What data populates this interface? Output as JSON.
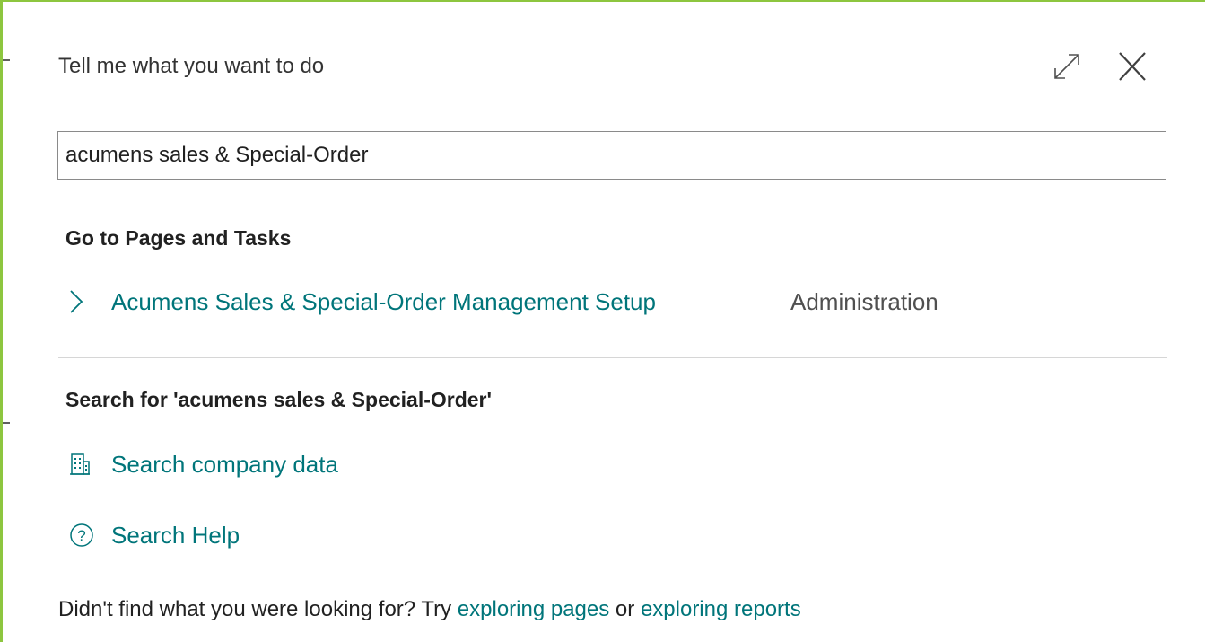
{
  "dialog": {
    "title": "Tell me what you want to do",
    "expand_icon": "expand-icon",
    "close_icon": "close-icon"
  },
  "search": {
    "value": "acumens sales & Special-Order",
    "placeholder": ""
  },
  "pages_section": {
    "heading": "Go to Pages and Tasks",
    "results": [
      {
        "icon": "chevron-right-icon",
        "label": "Acumens Sales & Special-Order Management Setup",
        "category": "Administration"
      }
    ]
  },
  "search_section": {
    "heading": "Search for 'acumens sales & Special-Order'",
    "items": [
      {
        "icon": "building-icon",
        "label": "Search company data"
      },
      {
        "icon": "help-circle-icon",
        "label": "Search Help"
      }
    ]
  },
  "footer": {
    "prefix": "Didn't find what you were looking for? Try ",
    "link_pages": "exploring pages",
    "middle": " or ",
    "link_reports": "exploring reports"
  },
  "colors": {
    "accent_link": "#00757a",
    "frame_border": "#8dc63f",
    "text": "#212121"
  }
}
